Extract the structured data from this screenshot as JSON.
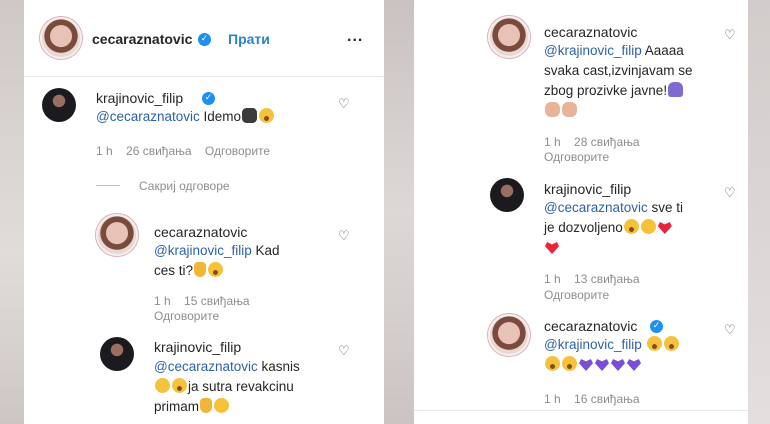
{
  "left_panel": {
    "header": {
      "username": "cecaraznatovic",
      "follow_label": "Прати",
      "more_label": "..."
    },
    "comment1": {
      "username": "krajinovic_filip",
      "mention": "@cecaraznatovic",
      "text": " Idemo",
      "time": "1 h",
      "likes": "26 свиђања",
      "reply": "Одговорите"
    },
    "hide_replies": "Сакриј одговоре",
    "reply1": {
      "username": "cecaraznatovic",
      "mention": "@krajinovic_filip",
      "text_line1": " Kad",
      "text_line2": "ces ti?",
      "time": "1 h",
      "likes": "15 свиђања",
      "reply": "Одговорите"
    },
    "reply2": {
      "username": "krajinovic_filip",
      "mention": "@cecaraznatovic",
      "text_line1": " kasnis",
      "text_line2": "ja sutra revakcinu",
      "text_line3": "primam"
    }
  },
  "right_panel": {
    "reply3": {
      "username": "cecaraznatovic",
      "mention": "@krajinovic_filip",
      "text_line1": " Aaaaa",
      "text_line2": "svaka cast,izvinjavam se",
      "text_line3": "zbog prozivke javne!",
      "time": "1 h",
      "likes": "28 свиђања",
      "reply": "Одговорите"
    },
    "reply4": {
      "username": "krajinovic_filip",
      "mention": "@cecaraznatovic",
      "text_line1": " sve ti",
      "text_line2": "je dozvoljeno",
      "time": "1 h",
      "likes": "13 свиђања",
      "reply": "Одговорите"
    },
    "reply5": {
      "username": "cecaraznatovic",
      "mention": "@krajinovic_filip",
      "time": "1 h",
      "likes": "16 свиђања"
    }
  },
  "icons": {
    "heart": "heart-outline-icon",
    "verified": "verified-badge-icon"
  },
  "colors": {
    "link": "#2e62a8",
    "follow": "#2a82d6",
    "verified": "#1e8ff3",
    "meta": "#8e8e8e"
  }
}
